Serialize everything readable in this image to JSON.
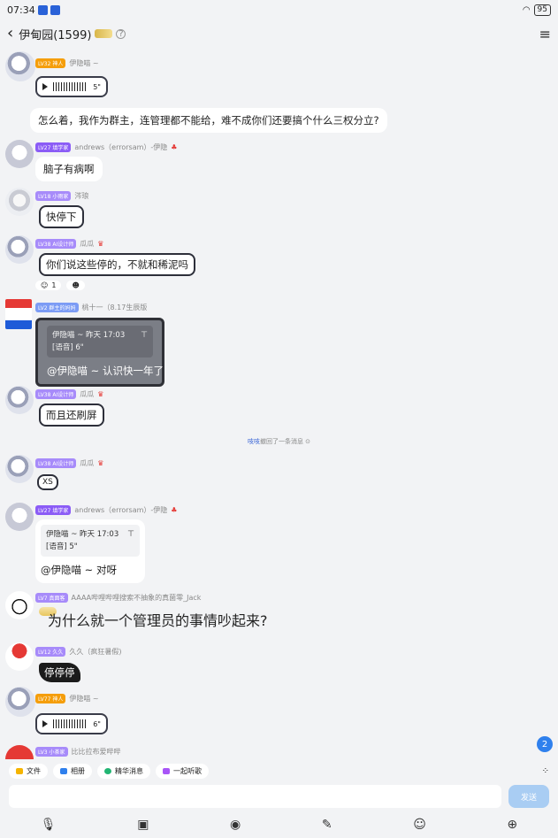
{
  "status": {
    "time": "07:34",
    "battery": "95"
  },
  "header": {
    "group_name": "伊甸园(1599)",
    "help": "?",
    "menu": "≡"
  },
  "messages": [
    {
      "level": "LV32",
      "title": "神人",
      "name": "伊隐喵 ~",
      "voice_seconds": "5\"",
      "text": "怎么着，我作为群主，连管理都不能给，难不成你们还要搞个什么三权分立?"
    },
    {
      "level": "LV27",
      "title": "填学家",
      "name": "andrews（errorsam）-伊隐",
      "text": "脑子有病啊"
    },
    {
      "level": "LV18",
      "title": "小雨家",
      "name": "涔琅",
      "text": "快停下"
    },
    {
      "level": "LV38",
      "title": "AI设计师",
      "name": "瓜瓜",
      "text": "你们说这些停的，不就和稀泥吗",
      "react_count": "1"
    },
    {
      "level": "LV2",
      "title": "群主的妈妈",
      "name": "桃十一（8.17生辰版",
      "quote_line1": "伊隐喵 ~ 昨天 17:03",
      "quote_line2": "[语音] 6\"",
      "text": "@伊隐喵 ~ 认识快一年了"
    },
    {
      "level": "LV38",
      "title": "AI设计师",
      "name": "瓜瓜",
      "text": "而且还刷屏"
    },
    {
      "level": "LV38",
      "title": "AI设计师",
      "name": "瓜瓜",
      "text": "XS"
    },
    {
      "level": "LV27",
      "title": "填学家",
      "name": "andrews（errorsam）-伊隐",
      "quote_line1": "伊隐喵 ~ 昨天 17:03",
      "quote_line2": "[语音] 5\"",
      "text": "@伊隐喵 ~ 对呀"
    },
    {
      "level": "LV7",
      "title": "真面客",
      "name": "AAAA哔哩哔哩搜索不抽象的真菌零_Jack",
      "text": "为什么就一个管理员的事情吵起来?"
    },
    {
      "level": "LV12",
      "title": "久久",
      "name": "久久（疯狂暑假)",
      "text": "停停停"
    },
    {
      "level": "LV77",
      "title": "神人",
      "name": "伊隐喵 ~",
      "voice_seconds": "6\""
    },
    {
      "level": "LV3",
      "title": "小茶家",
      "name": "比比拉布爱哔哔"
    }
  ],
  "notice": {
    "who": "吱吱",
    "rest": "撤回了一条消息"
  },
  "unread_count": "2",
  "quick_tools": [
    "文件",
    "相册",
    "精华消息",
    "一起听歌"
  ],
  "send_label": "发送",
  "bottom_icons": [
    "mic-icon",
    "image-icon",
    "camera-icon",
    "sticker-icon",
    "emoji-icon",
    "plus-icon"
  ]
}
